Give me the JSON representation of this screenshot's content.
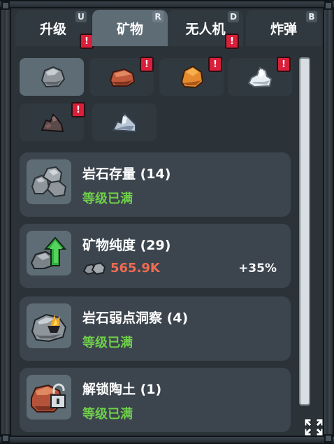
{
  "tabs": [
    {
      "label": "升级",
      "key": "U",
      "alert": "!"
    },
    {
      "label": "矿物",
      "key": "R"
    },
    {
      "label": "无人机",
      "key": "D",
      "alert": "!"
    },
    {
      "label": "炸弹",
      "key": "B"
    }
  ],
  "ores": [
    {
      "name": "rock",
      "alert": ""
    },
    {
      "name": "clay",
      "alert": "!"
    },
    {
      "name": "copper",
      "alert": "!"
    },
    {
      "name": "silver-crystal",
      "alert": "!"
    },
    {
      "name": "dark-ore",
      "alert": "!"
    },
    {
      "name": "blue-crystal",
      "alert": ""
    }
  ],
  "upgrades": [
    {
      "title": "岩石存量 (14)",
      "status": "等级已满",
      "icon": "rock-pile-icon"
    },
    {
      "title": "矿物纯度 (29)",
      "cost": "565.9K",
      "bonus": "+35%",
      "icon": "rock-purity-icon"
    },
    {
      "title": "岩石弱点洞察 (4)",
      "status": "等级已满",
      "icon": "rock-weakness-icon"
    },
    {
      "title": "解锁陶土 (1)",
      "status": "等级已满",
      "icon": "unlock-clay-icon"
    }
  ],
  "colors": {
    "status_green": "#6fd04a",
    "cost_red": "#f06b52",
    "alert_red": "#d8203a",
    "active_tab": "#5e6c75"
  }
}
